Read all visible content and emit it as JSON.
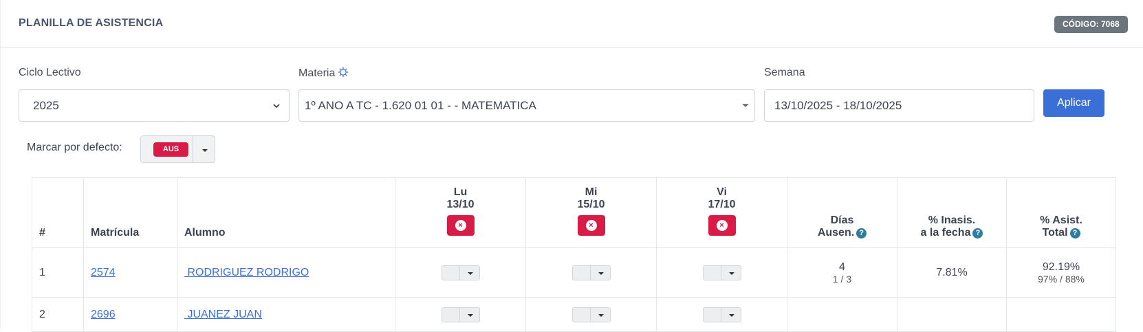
{
  "header": {
    "title": "PLANILLA DE ASISTENCIA",
    "code_badge": "CÓDIGO: 7068"
  },
  "filters": {
    "ciclo": {
      "label": "Ciclo Lectivo",
      "value": "2025"
    },
    "materia": {
      "label": "Materia",
      "value": "1º ANO A TC - 1.620 01 01 - - MATEMATICA",
      "icon": "gear-icon"
    },
    "semana": {
      "label": "Semana",
      "value": "13/10/2025 - 18/10/2025"
    },
    "apply_label": "Aplicar"
  },
  "default_mark": {
    "label": "Marcar por defecto:",
    "value": "AUS"
  },
  "table": {
    "headers": {
      "num": "#",
      "matricula": "Matrícula",
      "alumno": "Alumno",
      "dias_line1": "Días",
      "dias_line2": "Ausen.",
      "inasis_line1": "% Inasis.",
      "inasis_line2": "a la fecha",
      "asist_line1": "% Asist.",
      "asist_line2": "Total"
    },
    "days": [
      {
        "name": "Lu",
        "date": "13/10"
      },
      {
        "name": "Mi",
        "date": "15/10"
      },
      {
        "name": "Vi",
        "date": "17/10"
      }
    ],
    "rows": [
      {
        "num": "1",
        "matricula": "2574",
        "alumno": " RODRIGUEZ RODRIGO",
        "dias": "4",
        "dias_a": "1",
        "dias_sep": "/",
        "dias_b": "3",
        "inasis": "7.81%",
        "asist": "92.19%",
        "asist_a": "97%",
        "asist_sep": "/",
        "asist_b": "88%"
      },
      {
        "num": "2",
        "matricula": "2696",
        "alumno": " JUANEZ JUAN",
        "dias": "",
        "inasis": "",
        "asist": ""
      }
    ]
  },
  "colors": {
    "primary": "#3a6fd8",
    "danger": "#d81b47",
    "badge": "#6c757d",
    "info": "#2c7da0"
  }
}
